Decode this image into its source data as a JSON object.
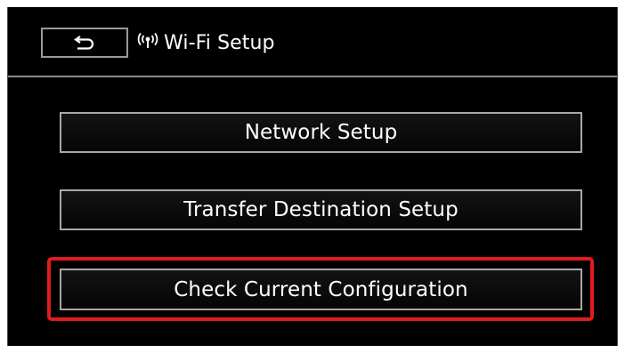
{
  "header": {
    "back_icon": "return-arrow-icon",
    "wifi_icon": "wifi-signal-icon",
    "title": "Wi-Fi Setup"
  },
  "menu": {
    "items": [
      {
        "label": "Network Setup",
        "selected": false
      },
      {
        "label": "Transfer Destination Setup",
        "selected": false
      },
      {
        "label": "Check Current Configuration",
        "selected": true
      }
    ]
  },
  "colors": {
    "background": "#000000",
    "text": "#ffffff",
    "button_border": "#a8a8a8",
    "highlight": "#e01c1c"
  }
}
